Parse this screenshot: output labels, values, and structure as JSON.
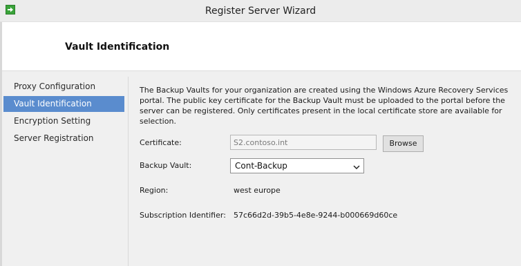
{
  "window": {
    "title": "Register Server Wizard",
    "app_icon": "green-arrow-icon"
  },
  "header": {
    "page_title": "Vault Identification"
  },
  "sidebar": {
    "items": [
      {
        "label": "Proxy Configuration",
        "active": false
      },
      {
        "label": "Vault Identification",
        "active": true
      },
      {
        "label": "Encryption Setting",
        "active": false
      },
      {
        "label": "Server Registration",
        "active": false
      }
    ]
  },
  "main": {
    "description": "The Backup Vaults for your organization are created using the Windows Azure Recovery Services portal. The public key certificate for the Backup Vault must be uploaded to the portal before the server can be registered. Only certificates present in the local certificate store are available for selection.",
    "certificate": {
      "label": "Certificate:",
      "value": "S2.contoso.int",
      "browse_label": "Browse"
    },
    "backup_vault": {
      "label": "Backup Vault:",
      "value": "Cont-Backup"
    },
    "region": {
      "label": "Region:",
      "value": "west europe"
    },
    "subscription": {
      "label": "Subscription Identifier:",
      "value": "57c66d2d-39b5-4e8e-9244-b000669d60ce"
    }
  },
  "colors": {
    "active_item_bg": "#5a8cce",
    "app_icon": "#3aa33a"
  }
}
